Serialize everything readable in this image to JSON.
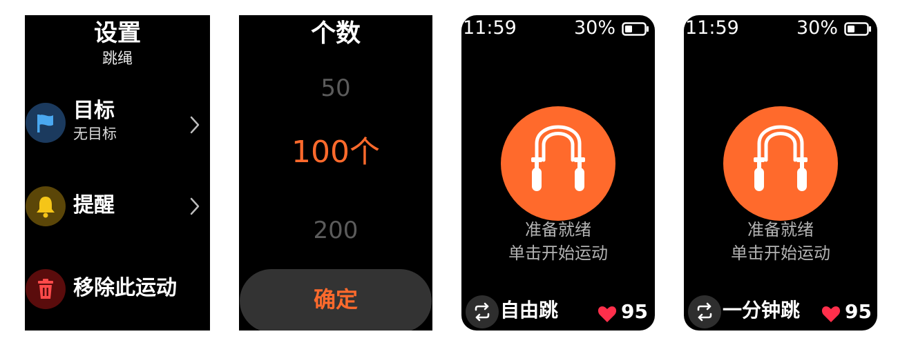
{
  "settings_screen": {
    "title": "设置",
    "subtitle": "跳绳",
    "items": [
      {
        "label": "目标",
        "value": "无目标",
        "icon": "flag-icon",
        "icon_bg": "#1b3a5e",
        "icon_color": "#4aa8f0"
      },
      {
        "label": "提醒",
        "icon": "bell-icon",
        "icon_bg": "#5b4608",
        "icon_color": "#f5c518"
      },
      {
        "label": "移除此运动",
        "icon": "trash-icon",
        "icon_bg": "#5a0c0c",
        "icon_color": "#ff4a4a"
      }
    ]
  },
  "count_picker": {
    "title": "个数",
    "options": [
      "50",
      "100个",
      "200"
    ],
    "selected": "100个",
    "confirm_label": "确定"
  },
  "workout_screens": [
    {
      "time": "11:59",
      "battery": "30%",
      "start_icon": "jump-rope-icon",
      "status_line1": "准备就绪",
      "status_line2": "单击开始运动",
      "mode_icon": "repeat-icon",
      "mode": "自由跳",
      "heart_rate": "95"
    },
    {
      "time": "11:59",
      "battery": "30%",
      "start_icon": "jump-rope-icon",
      "status_line1": "准备就绪",
      "status_line2": "单击开始运动",
      "mode_icon": "repeat-icon",
      "mode": "一分钟跳",
      "heart_rate": "95"
    }
  ],
  "colors": {
    "accent": "#ff6a2c",
    "background": "#000000",
    "heart": "#ff2f4b"
  }
}
